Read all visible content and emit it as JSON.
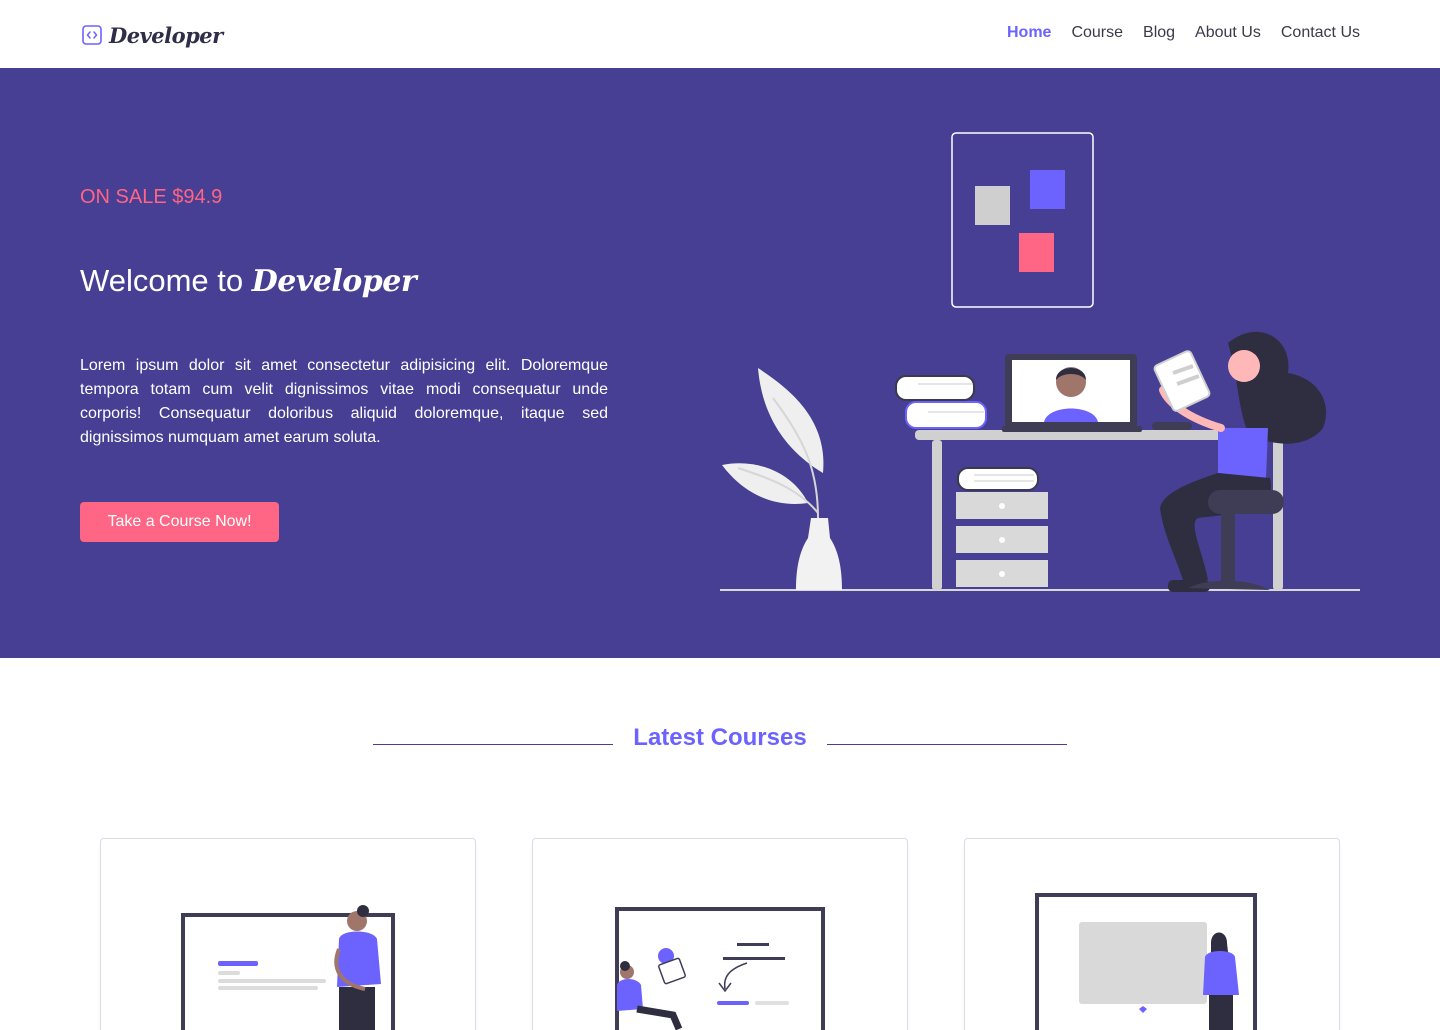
{
  "nav": {
    "brand": "Developer",
    "links": [
      {
        "label": "Home",
        "active": true
      },
      {
        "label": "Course",
        "active": false
      },
      {
        "label": "Blog",
        "active": false
      },
      {
        "label": "About Us",
        "active": false
      },
      {
        "label": "Contact Us",
        "active": false
      }
    ]
  },
  "hero": {
    "sale": "ON SALE $94.9",
    "welcome_prefix": "Welcome to",
    "welcome_brand": "Developer",
    "description": "Lorem ipsum dolor sit amet consectetur adipisicing elit. Doloremque tempora totam cum velit dignissimos vitae modi consequatur unde corporis! Consequatur doloribus aliquid doloremque, itaque sed dignissimos numquam amet earum soluta.",
    "cta": "Take a Course Now!"
  },
  "courses": {
    "title": "Latest Courses"
  },
  "colors": {
    "accent": "#6c63ff",
    "hero_bg": "#463f93",
    "pink": "#ff6584"
  }
}
